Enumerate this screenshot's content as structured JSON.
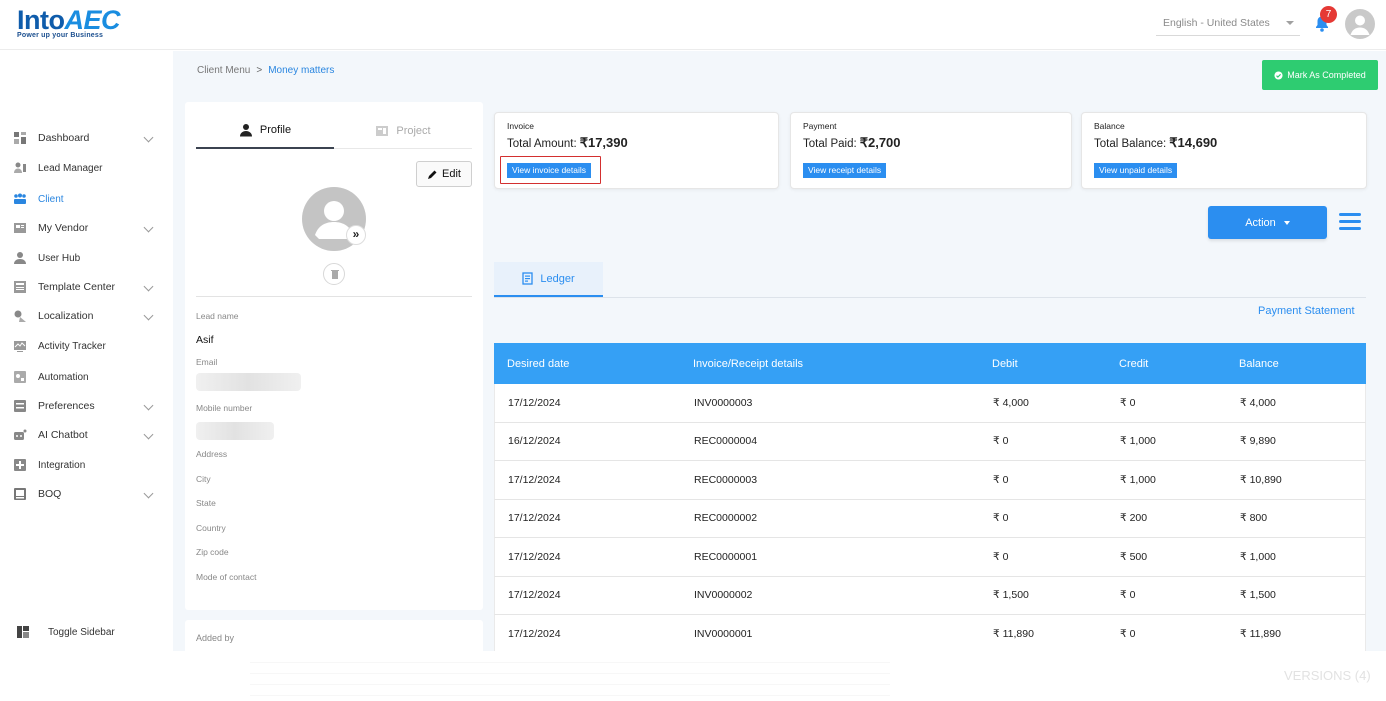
{
  "header": {
    "logo_main": "Into",
    "logo_accent": "AEC",
    "logo_tagline": "Power up your Business",
    "language": "English - United States",
    "notification_count": "7"
  },
  "sidebar": {
    "items": [
      {
        "label": "Dashboard",
        "icon": "dashboard-icon",
        "has_chevron": true
      },
      {
        "label": "Lead Manager",
        "icon": "lead-manager-icon",
        "has_chevron": false
      },
      {
        "label": "Client",
        "icon": "client-icon",
        "has_chevron": false,
        "active": true
      },
      {
        "label": "My Vendor",
        "icon": "vendor-icon",
        "has_chevron": true
      },
      {
        "label": "User Hub",
        "icon": "user-hub-icon",
        "has_chevron": false
      },
      {
        "label": "Template Center",
        "icon": "template-icon",
        "has_chevron": true
      },
      {
        "label": "Localization",
        "icon": "localization-icon",
        "has_chevron": true
      },
      {
        "label": "Activity Tracker",
        "icon": "activity-icon",
        "has_chevron": false
      },
      {
        "label": "Automation",
        "icon": "automation-icon",
        "has_chevron": false
      },
      {
        "label": "Preferences",
        "icon": "preferences-icon",
        "has_chevron": true
      },
      {
        "label": "AI Chatbot",
        "icon": "chatbot-icon",
        "has_chevron": true
      },
      {
        "label": "Integration",
        "icon": "integration-icon",
        "has_chevron": false
      },
      {
        "label": "BOQ",
        "icon": "boq-icon",
        "has_chevron": true
      }
    ],
    "toggle_label": "Toggle Sidebar"
  },
  "breadcrumb": {
    "parent": "Client Menu",
    "separator": ">",
    "current": "Money matters"
  },
  "mark_completed_label": "Mark As Completed",
  "profile": {
    "tab_profile": "Profile",
    "tab_project": "Project",
    "edit_label": "Edit",
    "fields": {
      "lead_name_label": "Lead name",
      "lead_name_value": "Asif",
      "email_label": "Email",
      "mobile_label": "Mobile number",
      "address_label": "Address",
      "city_label": "City",
      "state_label": "State",
      "country_label": "Country",
      "zip_label": "Zip code",
      "contact_mode_label": "Mode of contact"
    },
    "added_by_label": "Added by"
  },
  "summary": {
    "invoice": {
      "title": "Invoice",
      "label": "Total Amount:",
      "value": "₹17,390",
      "button": "View invoice details"
    },
    "payment": {
      "title": "Payment",
      "label": "Total Paid:",
      "value": "₹2,700",
      "button": "View receipt details"
    },
    "balance": {
      "title": "Balance",
      "label": "Total Balance:",
      "value": "₹14,690",
      "button": "View unpaid details"
    }
  },
  "action_label": "Action",
  "ledger_tab": "Ledger",
  "payment_statement": "Payment Statement",
  "table": {
    "headers": [
      "Desired date",
      "Invoice/Receipt details",
      "Debit",
      "Credit",
      "Balance"
    ],
    "rows": [
      [
        "17/12/2024",
        "INV0000003",
        "₹ 4,000",
        "₹ 0",
        "₹ 4,000"
      ],
      [
        "16/12/2024",
        "REC0000004",
        "₹ 0",
        "₹ 1,000",
        "₹ 9,890"
      ],
      [
        "17/12/2024",
        "REC0000003",
        "₹ 0",
        "₹ 1,000",
        "₹ 10,890"
      ],
      [
        "17/12/2024",
        "REC0000002",
        "₹ 0",
        "₹ 200",
        "₹ 800"
      ],
      [
        "17/12/2024",
        "REC0000001",
        "₹ 0",
        "₹ 500",
        "₹ 1,000"
      ],
      [
        "17/12/2024",
        "INV0000002",
        "₹ 1,500",
        "₹ 0",
        "₹ 1,500"
      ],
      [
        "17/12/2024",
        "INV0000001",
        "₹ 11,890",
        "₹ 0",
        "₹ 11,890"
      ]
    ]
  },
  "versions_label": "VERSIONS (4)",
  "colors": {
    "primary": "#2b8ef0",
    "table_header": "#35a0f5",
    "success": "#2ecc71",
    "highlight": "#d32f2f",
    "badge": "#e53935"
  }
}
